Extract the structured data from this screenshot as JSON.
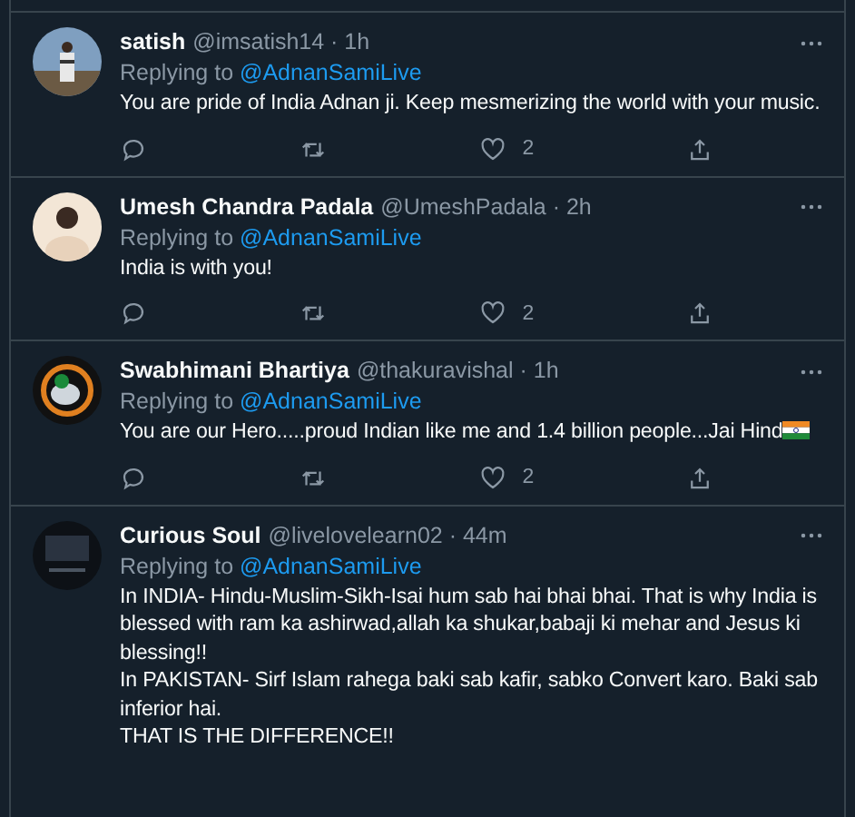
{
  "tweets": [
    {
      "name": "satish",
      "handle_time": "@imsatish14 · 1h",
      "replying_prefix": "Replying to",
      "replying_to": "@AdnanSamiLive",
      "text": "You are pride of India Adnan ji. Keep mesmerizing the world with your music.",
      "actions": {
        "likes": "2"
      }
    },
    {
      "name": "Umesh Chandra Padala",
      "handle_time": "@UmeshPadala · 2h",
      "replying_prefix": "Replying to",
      "replying_to": "@AdnanSamiLive",
      "text": "India is with you!",
      "actions": {
        "likes": "2"
      }
    },
    {
      "name": "Swabhimani Bhartiya",
      "handle_time": "@thakuravishal · 1h",
      "replying_prefix": "Replying to",
      "replying_to": "@AdnanSamiLive",
      "text": "You are our Hero.....proud Indian like me and 1.4 billion people...Jai Hind",
      "flag_emoji": true,
      "actions": {
        "likes": "2"
      }
    },
    {
      "name": "Curious Soul",
      "handle_time": "@livelovelearn02 · 44m",
      "replying_prefix": "Replying to",
      "replying_to": "@AdnanSamiLive",
      "text": "In INDIA- Hindu-Muslim-Sikh-Isai hum sab hai bhai bhai. That is why India is blessed with ram ka ashirwad,allah ka shukar,babaji ki mehar and Jesus ki blessing!!\nIn PAKISTAN- Sirf Islam rahega baki sab kafir, sabko Convert karo. Baki sab inferior hai.\nTHAT IS THE DIFFERENCE!!"
    }
  ]
}
